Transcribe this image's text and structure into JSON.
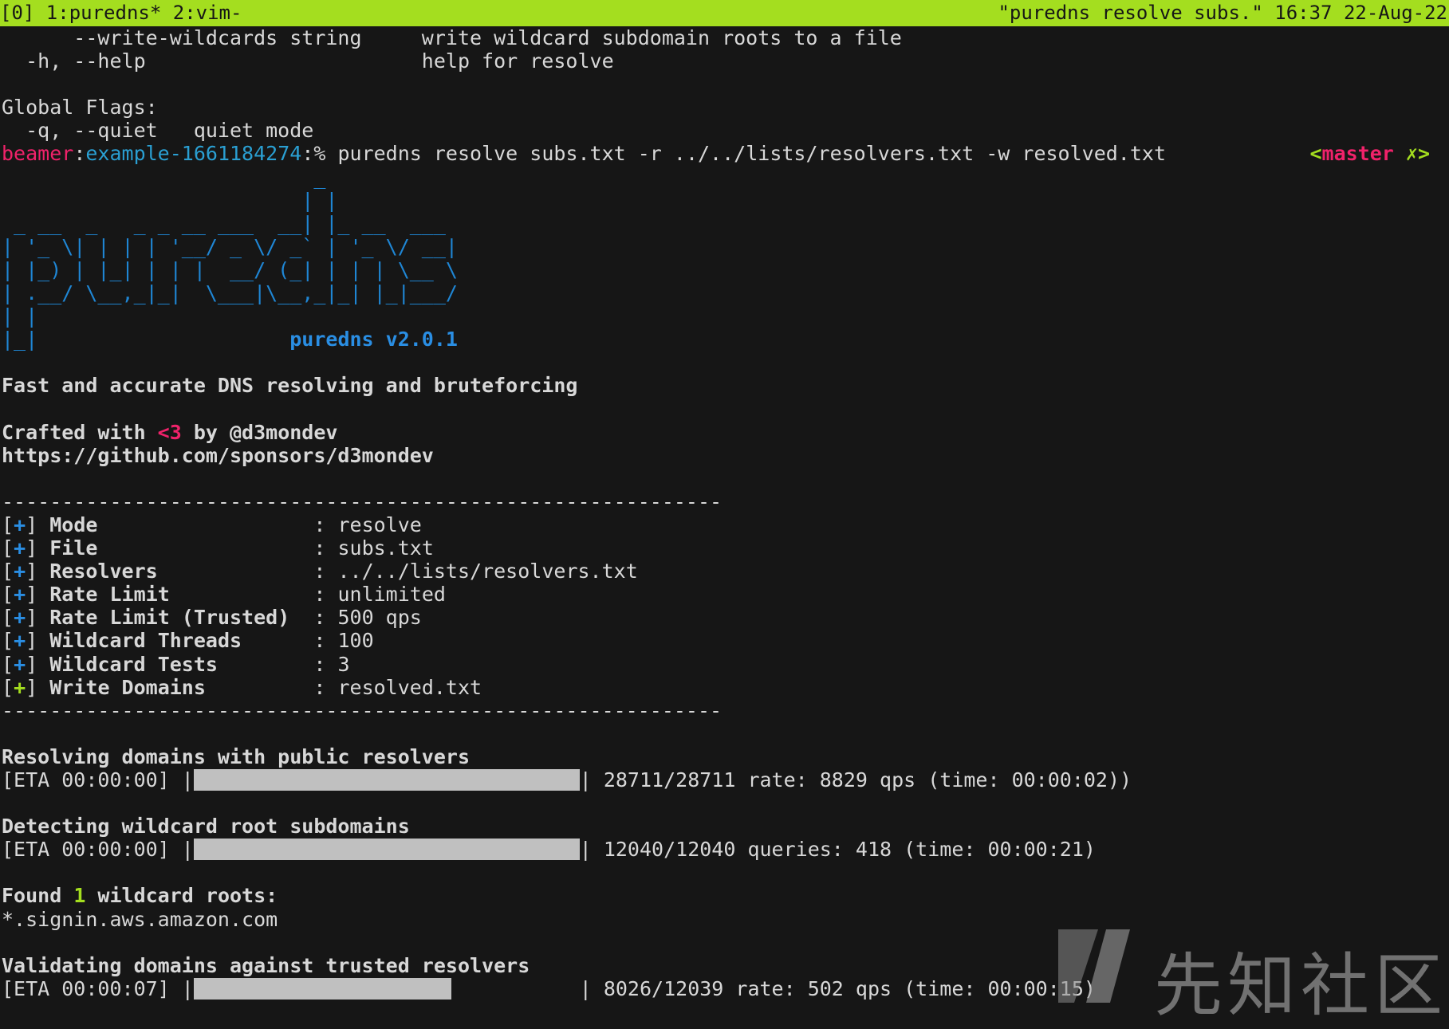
{
  "tmux": {
    "left": "[0] 1:puredns* 2:vim-",
    "right": "\"puredns resolve subs.\" 16:37 22-Aug-22"
  },
  "help_lines": [
    "      --write-wildcards string     write wildcard subdomain roots to a file",
    "  -h, --help                       help for resolve",
    "",
    "Global Flags:",
    "  -q, --quiet   quiet mode"
  ],
  "prompt": {
    "user": "beamer",
    "sep": ":",
    "dir": "example-1661184274",
    "symbol": ":% ",
    "command": "puredns resolve subs.txt -r ../../lists/resolvers.txt -w resolved.txt",
    "branch_open": "<",
    "branch_name": "master",
    "branch_status": " ✗>"
  },
  "banner": {
    "art": [
      "                          _",
      "                         | |",
      " _ __  _   _ _ __ ___  __| |_ __  ___",
      "| '_ \\| | | | '__/ _ \\/ _` | '_ \\/ __|",
      "| |_) | |_| | | |  __/ (_| | | | \\__ \\",
      "| .__/ \\__,_|_|  \\___|\\__,_|_| |_|___/",
      "| |",
      "|_|                     "
    ],
    "version": "puredns v2.0.1",
    "tagline": "Fast and accurate DNS resolving and bruteforcing",
    "crafted_prefix": "Crafted with ",
    "crafted_heart": "<3",
    "crafted_suffix": " by @d3mondev",
    "sponsor_url": "https://github.com/sponsors/d3mondev"
  },
  "separator": "------------------------------------------------------------",
  "config": [
    {
      "bracket_open": "[",
      "plus": "+",
      "bracket_close": "] ",
      "key": "Mode                 ",
      "sep": " : ",
      "value": "resolve"
    },
    {
      "bracket_open": "[",
      "plus": "+",
      "bracket_close": "] ",
      "key": "File                 ",
      "sep": " : ",
      "value": "subs.txt"
    },
    {
      "bracket_open": "[",
      "plus": "+",
      "bracket_close": "] ",
      "key": "Resolvers            ",
      "sep": " : ",
      "value": "../../lists/resolvers.txt"
    },
    {
      "bracket_open": "[",
      "plus": "+",
      "bracket_close": "] ",
      "key": "Rate Limit           ",
      "sep": " : ",
      "value": "unlimited"
    },
    {
      "bracket_open": "[",
      "plus": "+",
      "bracket_close": "] ",
      "key": "Rate Limit (Trusted) ",
      "sep": " : ",
      "value": "500 qps"
    },
    {
      "bracket_open": "[",
      "plus": "+",
      "bracket_close": "] ",
      "key": "Wildcard Threads     ",
      "sep": " : ",
      "value": "100"
    },
    {
      "bracket_open": "[",
      "plus": "+",
      "bracket_close": "] ",
      "key": "Wildcard Tests       ",
      "sep": " : ",
      "value": "3"
    },
    {
      "bracket_open": "[",
      "plus": "+",
      "bracket_close": "] ",
      "key": "Write Domains        ",
      "sep": " : ",
      "value": "resolved.txt"
    }
  ],
  "phases": [
    {
      "title": "Resolving domains with public resolvers",
      "eta": "[ETA 00:00:00] ",
      "progress": 1.0,
      "stats": " 28711/28711 rate: 8829 qps (time: 00:00:02))"
    },
    {
      "title": "Detecting wildcard root subdomains",
      "eta": "[ETA 00:00:00] ",
      "progress": 1.0,
      "stats": " 12040/12040 queries: 418 (time: 00:00:21)"
    }
  ],
  "found": {
    "prefix": "Found ",
    "count": "1",
    "suffix": " wildcard roots:",
    "root": "*.signin.aws.amazon.com"
  },
  "validating": {
    "title": "Validating domains against trusted resolvers",
    "eta": "[ETA 00:00:07] ",
    "progress": 0.667,
    "stats": " 8026/12039 rate: 502 qps (time: 00:00:15)"
  },
  "pipe_char": "|",
  "watermark": {
    "text": "先知社区"
  },
  "colors": {
    "background": "#161616",
    "foreground": "#d8d8d8",
    "tmux_bar": "#a4de1f",
    "prompt_user": "#f0226a",
    "prompt_dir": "#2a9fd2",
    "banner": "#1f86d4",
    "accent_green": "#a4de1f",
    "progress_fill": "#c0c0c0"
  }
}
